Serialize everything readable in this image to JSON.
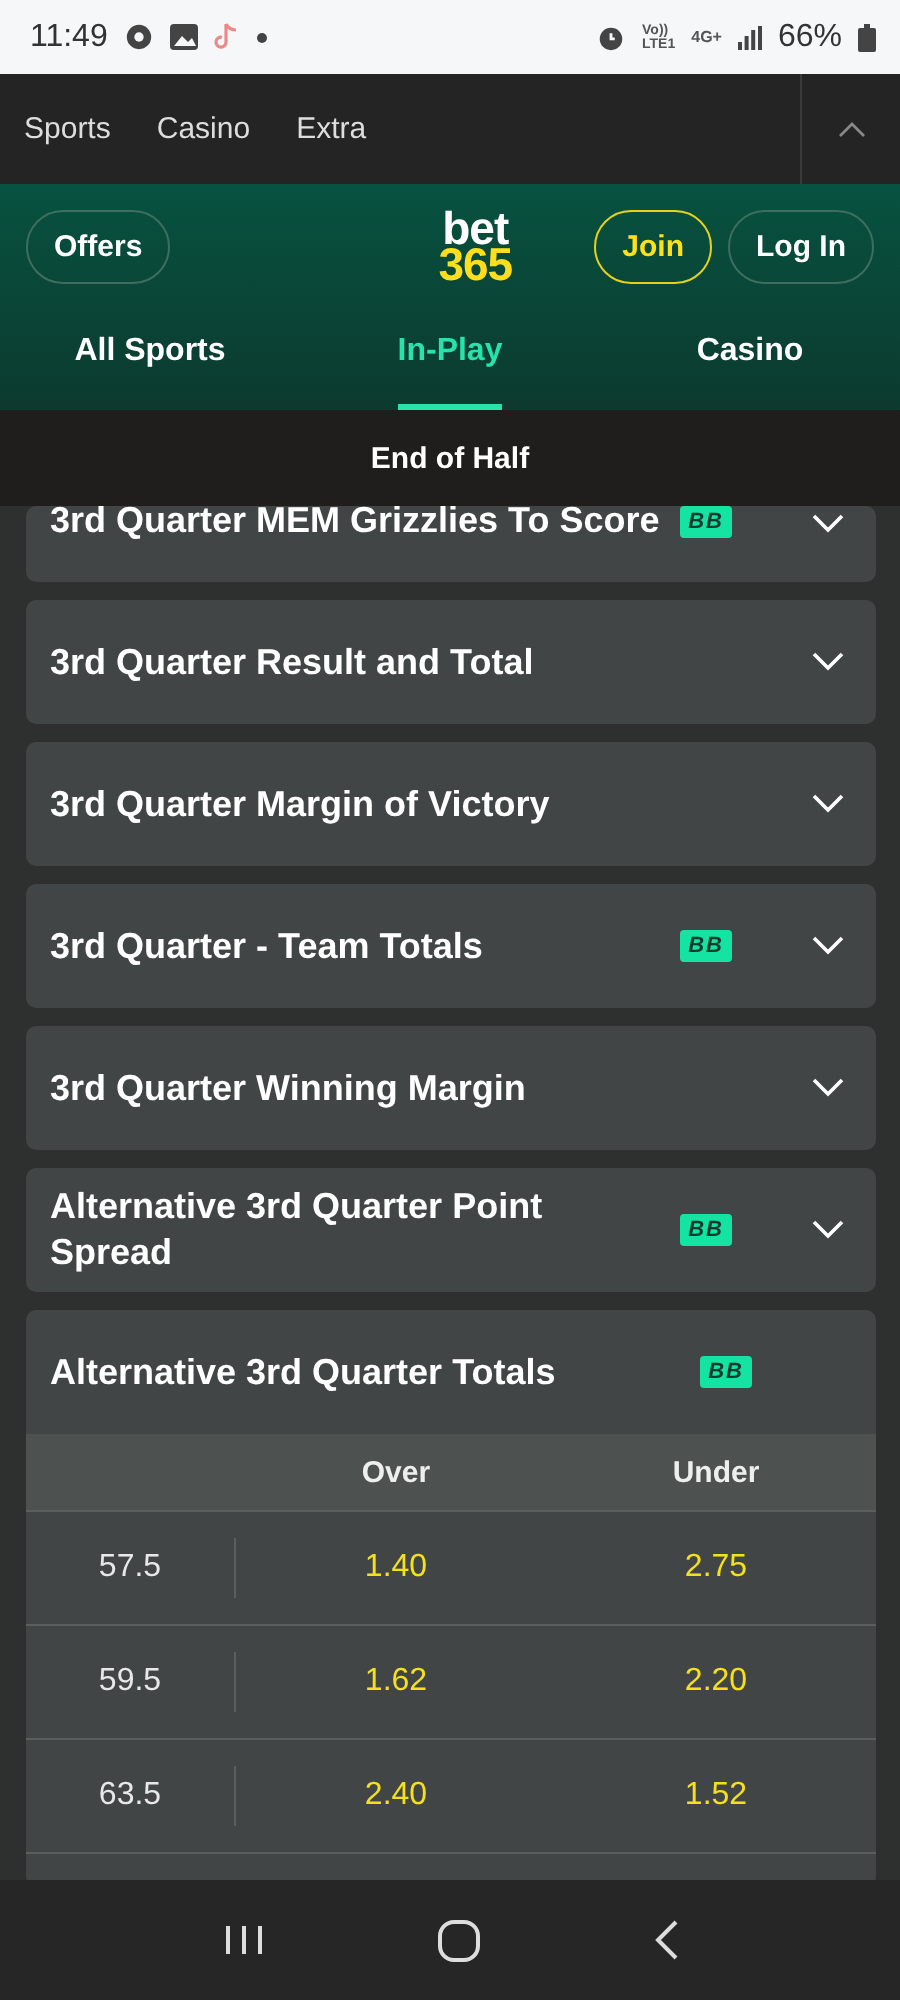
{
  "status_bar": {
    "time": "11:49",
    "volte": [
      "Vo))",
      "LTE1"
    ],
    "network": "4G+",
    "battery": "66%"
  },
  "top_nav": {
    "items": [
      "Sports",
      "Casino",
      "Extra"
    ]
  },
  "header": {
    "offers": "Offers",
    "logo": [
      "bet",
      "365"
    ],
    "join": "Join",
    "login": "Log In"
  },
  "tabs": [
    {
      "label": "All Sports",
      "selected": false
    },
    {
      "label": "In-Play",
      "selected": true
    },
    {
      "label": "Casino",
      "selected": false
    }
  ],
  "banner": "End of Half",
  "markets": [
    {
      "title": "3rd Quarter MEM Grizzlies To Score",
      "badge": "BB",
      "expanded": false,
      "clipped": true
    },
    {
      "title": "3rd Quarter Result and Total",
      "expanded": false
    },
    {
      "title": "3rd Quarter Margin of Victory",
      "expanded": false
    },
    {
      "title": "3rd Quarter - Team Totals",
      "badge": "BB",
      "expanded": false
    },
    {
      "title": "3rd Quarter Winning Margin",
      "expanded": false
    },
    {
      "title": "Alternative 3rd Quarter Point Spread",
      "badge": "BB",
      "expanded": false
    },
    {
      "title": "Alternative 3rd Quarter Totals",
      "badge": "BB",
      "expanded": true,
      "table": {
        "columns": [
          "Over",
          "Under"
        ],
        "rows": [
          {
            "line": "57.5",
            "over": "1.40",
            "under": "2.75"
          },
          {
            "line": "59.5",
            "over": "1.62",
            "under": "2.20"
          },
          {
            "line": "63.5",
            "over": "2.40",
            "under": "1.52"
          }
        ]
      }
    }
  ]
}
